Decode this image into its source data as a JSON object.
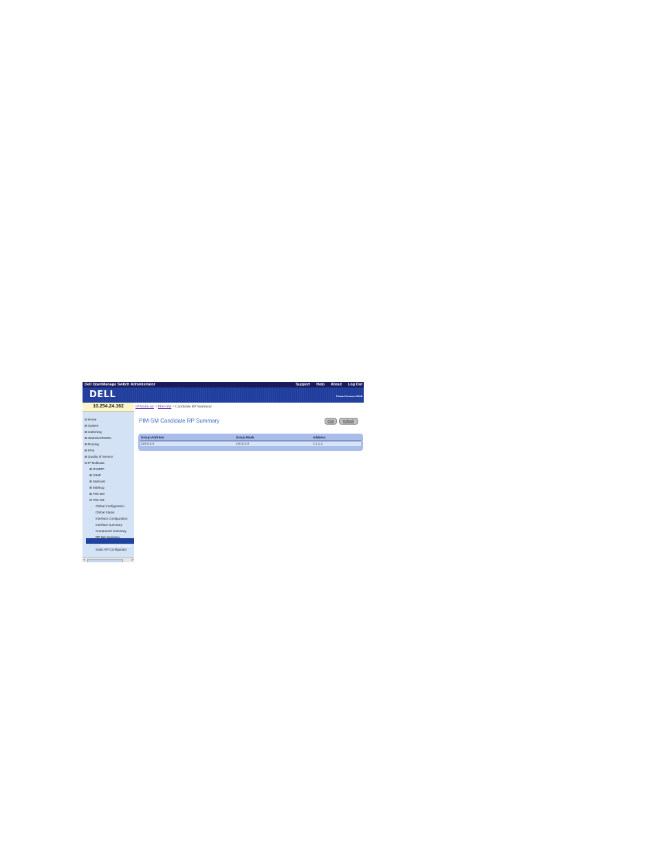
{
  "header": {
    "app_title": "Dell OpenManage Switch Administrator",
    "links": [
      "Support",
      "Help",
      "About",
      "Log Out"
    ],
    "logo": "DELL",
    "product": "PowerConnect 6248"
  },
  "ip_address": "10.254.24.162",
  "breadcrumb": {
    "link1": "IP Multicast",
    "sep1": " > ",
    "link2": "PIM-SM",
    "sep2": " > ",
    "current": "Candidate RP Summary"
  },
  "sidebar": {
    "items": [
      {
        "icon": "⊟",
        "label": "Home"
      },
      {
        "icon": "⊞",
        "label": "System"
      },
      {
        "icon": "⊞",
        "label": "Switching"
      },
      {
        "icon": "⊞",
        "label": "Statistics/RMON"
      },
      {
        "icon": "⊞",
        "label": "Routing"
      },
      {
        "icon": "⊞",
        "label": "IPv6"
      },
      {
        "icon": "⊞",
        "label": "Quality of Service"
      },
      {
        "icon": "⊟",
        "label": "IP Multicast"
      },
      {
        "icon": "⊞",
        "label": "DVMRP"
      },
      {
        "icon": "⊞",
        "label": "IGMP"
      },
      {
        "icon": "⊞",
        "label": "Multicast"
      },
      {
        "icon": "⊞",
        "label": "Mdebug"
      },
      {
        "icon": "⊞",
        "label": "PIM-DM"
      },
      {
        "icon": "⊟",
        "label": "PIM-SM"
      },
      {
        "icon": "",
        "label": "Global Configuration"
      },
      {
        "icon": "",
        "label": "Global Status"
      },
      {
        "icon": "",
        "label": "Interface Configuration"
      },
      {
        "icon": "",
        "label": "Interface Summary"
      },
      {
        "icon": "",
        "label": "Component Summary"
      },
      {
        "icon": "",
        "label": "RP Set Summary"
      },
      {
        "icon": "",
        "label": "Candidate RP Summ"
      },
      {
        "icon": "",
        "label": "Static RP Configuratio"
      }
    ],
    "scroll_left": "<",
    "scroll_right": ">"
  },
  "main": {
    "title": "PIM-SM Candidate RP Summary",
    "print_label": "Print",
    "refresh_label": "Refresh",
    "table": {
      "headers": [
        "Group Address",
        "Group Mask",
        "Address"
      ],
      "rows": [
        [
          "224.0.0.0",
          "240.0.0.0",
          "3.1.1.2"
        ]
      ]
    }
  },
  "colors": {
    "topbar": "#1c1c5c",
    "banner": "#1f3d9c",
    "sidebar": "#d4e2f6",
    "selected": "#1f44a0",
    "title_blue": "#3a6ac4",
    "panel": "#a9bde8"
  }
}
